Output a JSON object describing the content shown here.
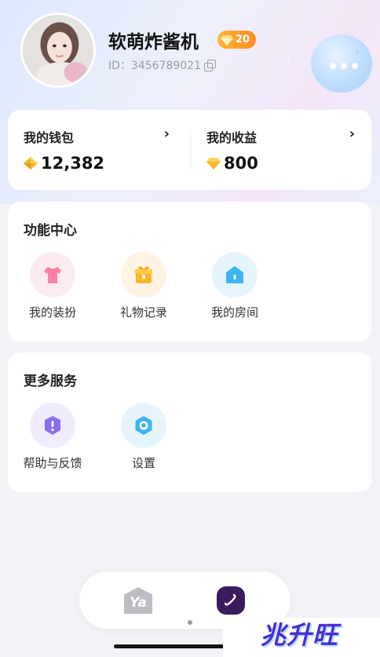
{
  "profile": {
    "nickname": "软萌炸酱机",
    "level": "20",
    "user_id": "ID：3456789021"
  },
  "wallet": {
    "balance_label": "我的钱包",
    "balance_value": "12,382",
    "earnings_label": "我的收益",
    "earnings_value": "800"
  },
  "features": {
    "title": "功能中心",
    "items": [
      {
        "label": "我的装扮",
        "icon": "shirt-icon"
      },
      {
        "label": "礼物记录",
        "icon": "gift-icon"
      },
      {
        "label": "我的房间",
        "icon": "house-icon"
      }
    ]
  },
  "more_services": {
    "title": "更多服务",
    "items": [
      {
        "label": "帮助与反馈",
        "icon": "help-icon"
      },
      {
        "label": "设置",
        "icon": "settings-icon"
      }
    ]
  },
  "tabbar": {
    "home_label": "Ya"
  },
  "watermark": "兆升旺",
  "colors": {
    "accent_orange": "#ff9a2a",
    "gem_gold": "#f7b52a",
    "page_bg": "#f2f2f7",
    "watermark_purple": "#4a2bd8"
  }
}
